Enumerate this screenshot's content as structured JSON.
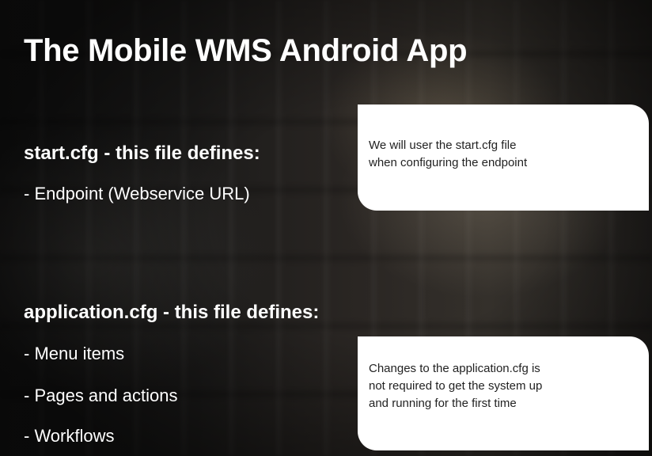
{
  "slide": {
    "title": "The Mobile WMS Android App",
    "sections": [
      {
        "heading": "start.cfg - this file defines:",
        "bullets": [
          "- Endpoint (Webservice URL)"
        ],
        "callout": {
          "lines": [
            "We will user the start.cfg file",
            "when configuring the endpoint"
          ]
        }
      },
      {
        "heading": "application.cfg - this file defines:",
        "bullets": [
          "- Menu items",
          "- Pages and actions",
          "- Workflows"
        ],
        "callout": {
          "lines": [
            "Changes to the application.cfg is",
            "not required to get the system up",
            "and running for the first time"
          ]
        }
      }
    ]
  },
  "colors": {
    "text": "#ffffff",
    "callout_background": "#ffffff",
    "callout_text": "#222222",
    "background": "#1c1b1a"
  }
}
